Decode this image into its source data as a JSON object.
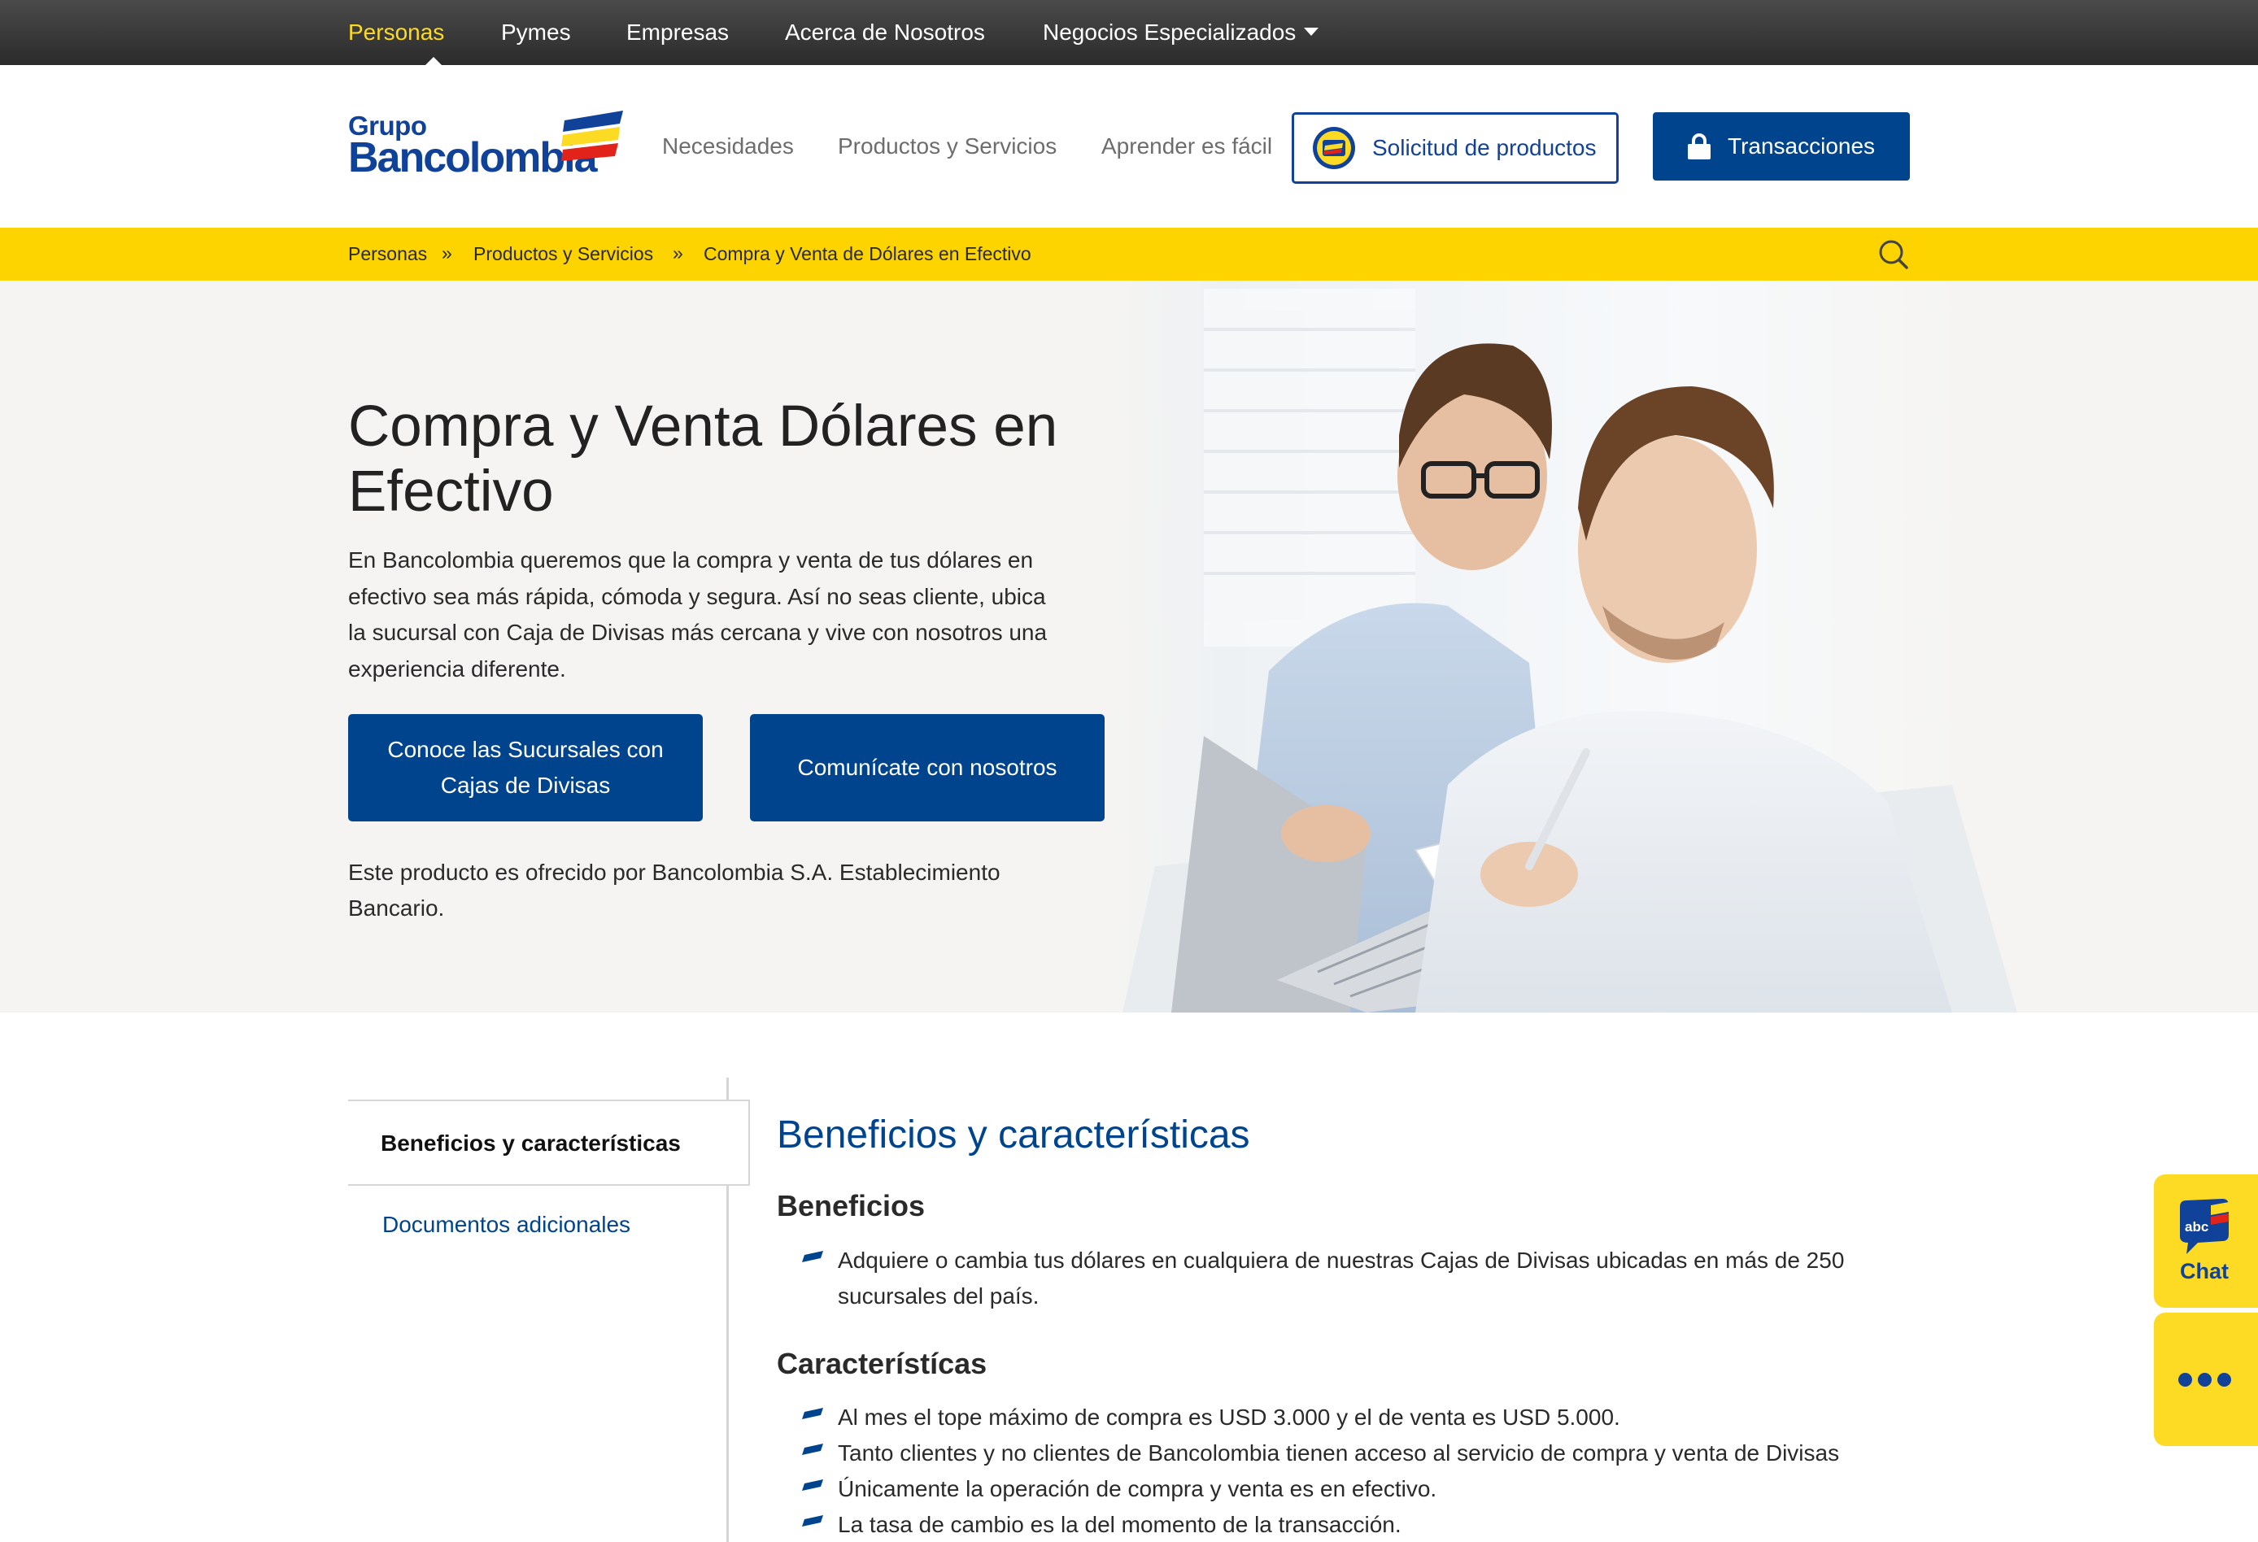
{
  "topnav": {
    "items": [
      "Personas",
      "Pymes",
      "Empresas",
      "Acerca de Nosotros",
      "Negocios Especializados"
    ]
  },
  "header": {
    "logo_top": "Grupo",
    "logo_bottom": "Bancolombia",
    "nav": [
      "Necesidades",
      "Productos y Servicios",
      "Aprender es fácil"
    ],
    "solicitud_label": "Solicitud de productos",
    "transacciones_label": "Transacciones"
  },
  "breadcrumb": {
    "items": [
      "Personas",
      "Productos y Servicios",
      "Compra y Venta de Dólares en Efectivo"
    ],
    "separator": "»"
  },
  "hero": {
    "title": "Compra y Venta Dólares en Efectivo",
    "intro": "En Bancolombia queremos que la compra y venta de tus dólares en efectivo sea más rápida, cómoda y segura. Así no seas cliente, ubica la sucursal con Caja de Divisas más cercana y vive con nosotros una experiencia diferente.",
    "btn_sucursales": "Conoce las Sucursales con Cajas de Divisas",
    "btn_comunicate": "Comunícate con nosotros",
    "disclaimer": "Este producto es ofrecido por Bancolombia S.A. Establecimiento Bancario."
  },
  "sidebar": {
    "active_tab": "Beneficios y características",
    "link": "Documentos adicionales"
  },
  "content": {
    "section_title": "Beneficios y características",
    "beneficios_title": "Beneficios",
    "beneficios": [
      "Adquiere o cambia tus dólares en cualquiera de nuestras Cajas de Divisas ubicadas en más de 250 sucursales del país."
    ],
    "caracteristicas_title": "Característícas",
    "caracteristicas": [
      "Al mes el tope máximo de compra es USD 3.000 y el de venta es USD 5.000.",
      "Tanto clientes y no clientes de Bancolombia tienen acceso al servicio de compra y venta de Divisas",
      "Únicamente la operación de compra y venta es en efectivo.",
      "La tasa de cambio es la del momento de la transacción."
    ]
  },
  "widgets": {
    "chat_badge": "abc",
    "chat_label": "Chat"
  },
  "colors": {
    "brand_blue": "#00448d",
    "logo_blue": "#11429a",
    "yellow": "#fdd300",
    "topbar": "#3a3a3a"
  }
}
